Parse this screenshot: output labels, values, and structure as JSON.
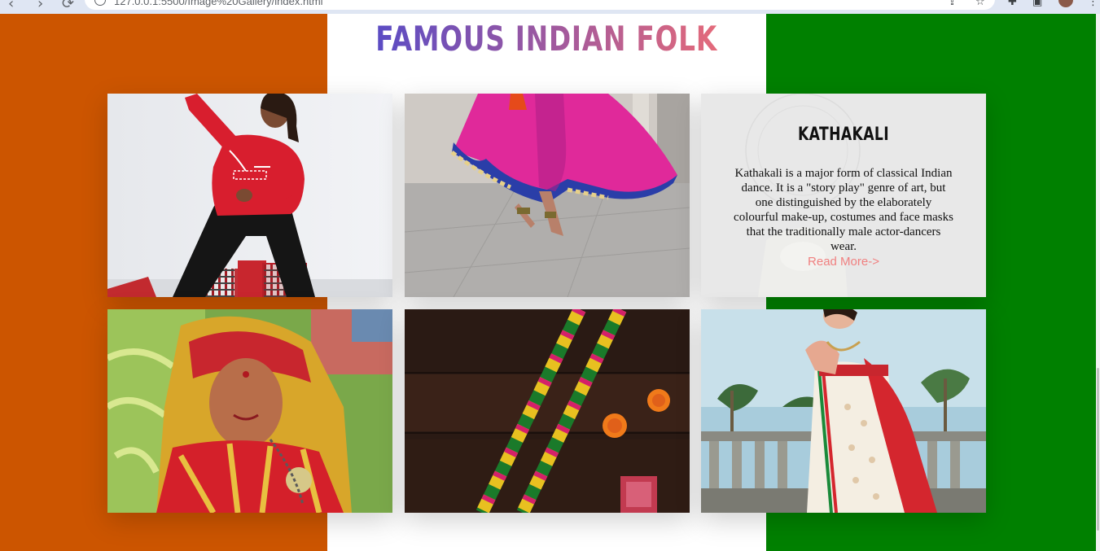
{
  "browser": {
    "url": "127.0.0.1:5500/Image%20Gallery/index.html"
  },
  "page": {
    "title": "FAMOUS INDIAN FOLK DANCE",
    "colors": {
      "left": "#cc5500",
      "center": "#ffffff",
      "right": "#008000",
      "title_gradient": [
        "#5b4cc4",
        "#e46a7a"
      ],
      "link": "#f08080"
    }
  },
  "gallery": {
    "info_card": {
      "title": "KATHAKALI",
      "text": "Kathakali is a major form of classical Indian dance. It is a \"story play\" genre of art, but one distinguished by the elaborately colourful make-up, costumes and face masks that the traditionally male actor-dancers wear.",
      "link": "Read More->"
    },
    "images": [
      {
        "subject": "dancer in red sweater"
      },
      {
        "subject": "pink skirt dancer feet"
      },
      {
        "subject": "kathakali dancer"
      },
      {
        "subject": "folk dancer in red and gold costume"
      },
      {
        "subject": "dandiya sticks and marigold flowers"
      },
      {
        "subject": "dancer in white saree"
      }
    ]
  }
}
